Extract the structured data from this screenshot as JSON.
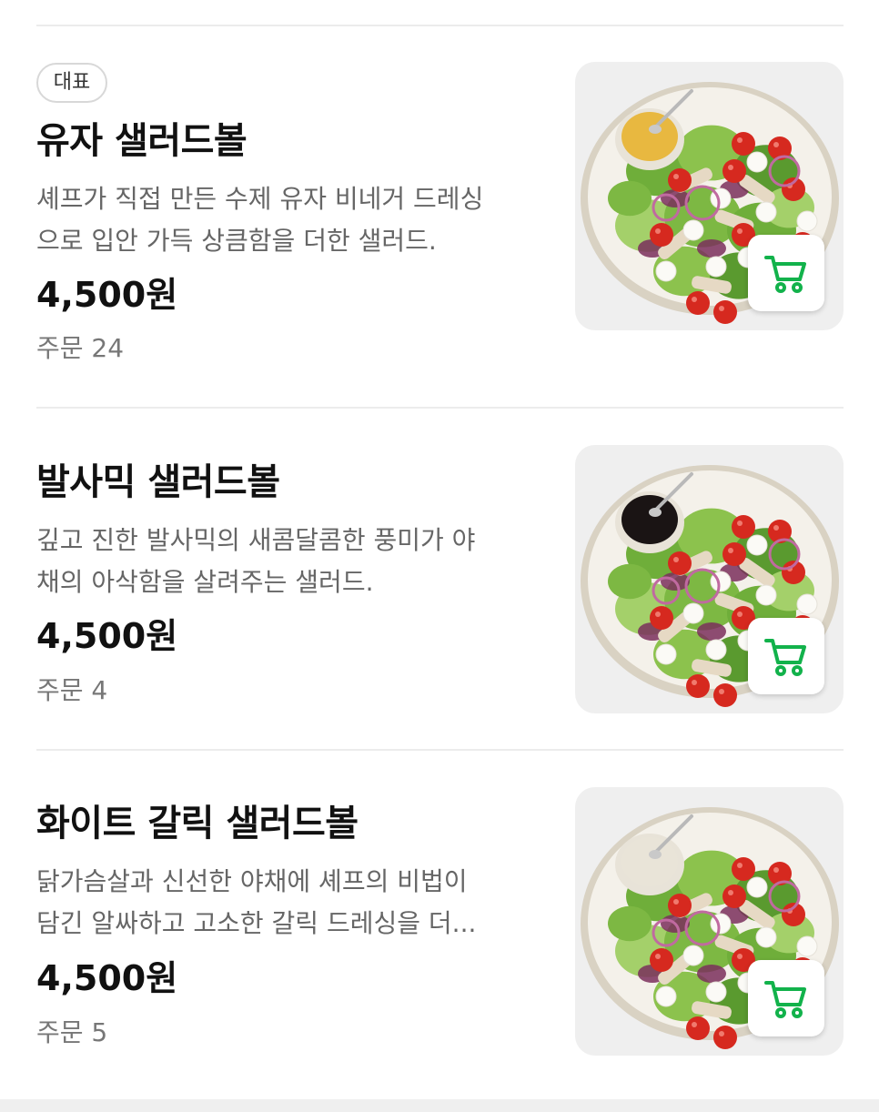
{
  "colors": {
    "accent_green": "#12b24b",
    "divider": "#ececec",
    "thumb_bg": "#efefef"
  },
  "menu_items": [
    {
      "badge": "대표",
      "name": "유자 샐러드볼",
      "desc_line1": "셰프가 직접 만든 수제 유자 비네거 드레싱",
      "desc_line2": "으로 입안 가득 상큼함을 더한 샐러드.",
      "price": "4,500원",
      "orders": "주문 24",
      "image": "yuzu-salad-bowl",
      "cart_icon": "cart-icon"
    },
    {
      "name": "발사믹 샐러드볼",
      "desc_line1": "깊고 진한 발사믹의 새콤달콤한 풍미가 야",
      "desc_line2": "채의 아삭함을 살려주는 샐러드.",
      "price": "4,500원",
      "orders": "주문 4",
      "image": "balsamic-salad-bowl",
      "cart_icon": "cart-icon"
    },
    {
      "name": "화이트 갈릭 샐러드볼",
      "desc_line1": "닭가슴살과 신선한 야채에 셰프의 비법이",
      "desc_line2": "담긴 알싸하고 고소한 갈릭 드레싱을 더...",
      "price": "4,500원",
      "orders": "주문 5",
      "image": "white-garlic-salad-bowl",
      "cart_icon": "cart-icon"
    }
  ]
}
